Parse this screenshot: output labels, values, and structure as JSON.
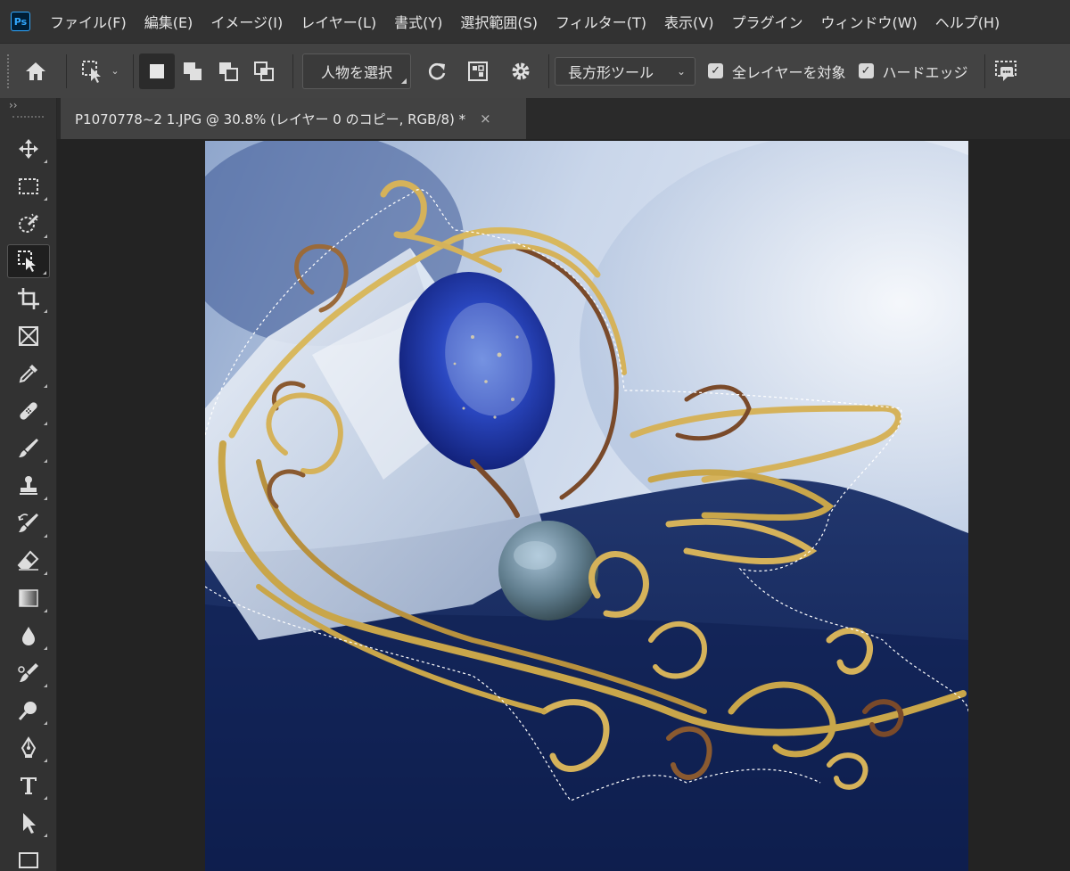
{
  "app": {
    "logo": "Ps"
  },
  "menu": [
    "ファイル(F)",
    "編集(E)",
    "イメージ(I)",
    "レイヤー(L)",
    "書式(Y)",
    "選択範囲(S)",
    "フィルター(T)",
    "表示(V)",
    "プラグイン",
    "ウィンドウ(W)",
    "ヘルプ(H)"
  ],
  "options": {
    "select_subject_label": "人物を選択",
    "mode_select_value": "長方形ツール",
    "sample_all_layers_label": "全レイヤーを対象",
    "hard_edge_label": "ハードエッジ",
    "sample_all_layers_checked": true,
    "hard_edge_checked": true
  },
  "toolbar": {
    "collapse_label": "››"
  },
  "document": {
    "tab_title": "P1070778~2 1.JPG @ 30.8% (レイヤー 0 のコピー, RGB/8) *",
    "close_glyph": "×"
  },
  "colors": {
    "menubar": "#323232",
    "optionsbar": "#434343",
    "accent_ps": "#31a8ff",
    "wire_gold": "#d4b25a",
    "wire_copper": "#7a4a2a",
    "stone_lapis": "#1f3aa8",
    "fabric_navy": "#13245c"
  }
}
